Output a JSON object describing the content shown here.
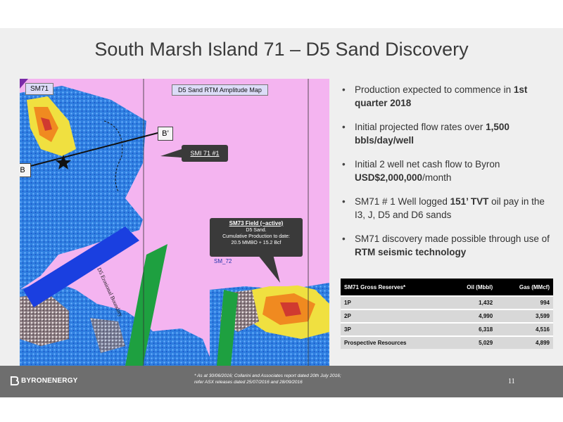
{
  "slide": {
    "title": "South Marsh Island 71 – D5 Sand Discovery",
    "page_number": "11"
  },
  "map": {
    "block_label": "SM71",
    "map_title": "D5 Sand RTM Amplitude Map",
    "b_prime": "B’",
    "b": "B",
    "well_label": "SMI 71 #1",
    "sm73_title": "SM73 Field (~active)",
    "sm73_line1": "D5 Sand.",
    "sm73_line2": "Cumulative Production to date:",
    "sm73_line3": "20.5 MMBO + 15.2 Bcf",
    "sm72_label": "SM_72",
    "boundary_label": "D5 Erosional Boundary"
  },
  "bullets": [
    {
      "pre": "Production expected to commence in ",
      "bold": "1st quarter 2018",
      "post": ""
    },
    {
      "pre": "Initial projected flow rates over ",
      "bold": "1,500 bbls/day/well",
      "post": ""
    },
    {
      "pre": "Initial 2 well net cash flow to Byron ",
      "bold": "USD$2,000,000",
      "post": "/month"
    },
    {
      "pre": "SM71 # 1 Well logged ",
      "bold": "151’ TVT",
      "post": " oil pay in the I3, J, D5 and D6 sands"
    },
    {
      "pre": "SM71 discovery made possible through use of ",
      "bold": "RTM seismic technology",
      "post": ""
    }
  ],
  "reserves": {
    "headers": [
      "SM71 Gross Reserves*",
      "Oil (Mbbl)",
      "Gas (MMcf)"
    ],
    "rows": [
      [
        "1P",
        "1,432",
        "994"
      ],
      [
        "2P",
        "4,990",
        "3,599"
      ],
      [
        "3P",
        "6,318",
        "4,516"
      ],
      [
        "Prospective Resources",
        "5,029",
        "4,899"
      ]
    ]
  },
  "footer": {
    "logo_text": "BYRONENERGY",
    "footnote_line1": "* As at 30/06/2016; Collarini and Associates report dated 20th July 2016;",
    "footnote_line2": "refer ASX releases dated 25/07/2016 and 28/09/2016"
  },
  "colors": {
    "map_pink": "#f4b4f0",
    "map_blue": "#2f7fe0",
    "fault_blue": "#1a3fe0",
    "fault_green": "#1ea040",
    "hot_yellow": "#f0e040",
    "footer_grey": "#6e6e6e"
  }
}
